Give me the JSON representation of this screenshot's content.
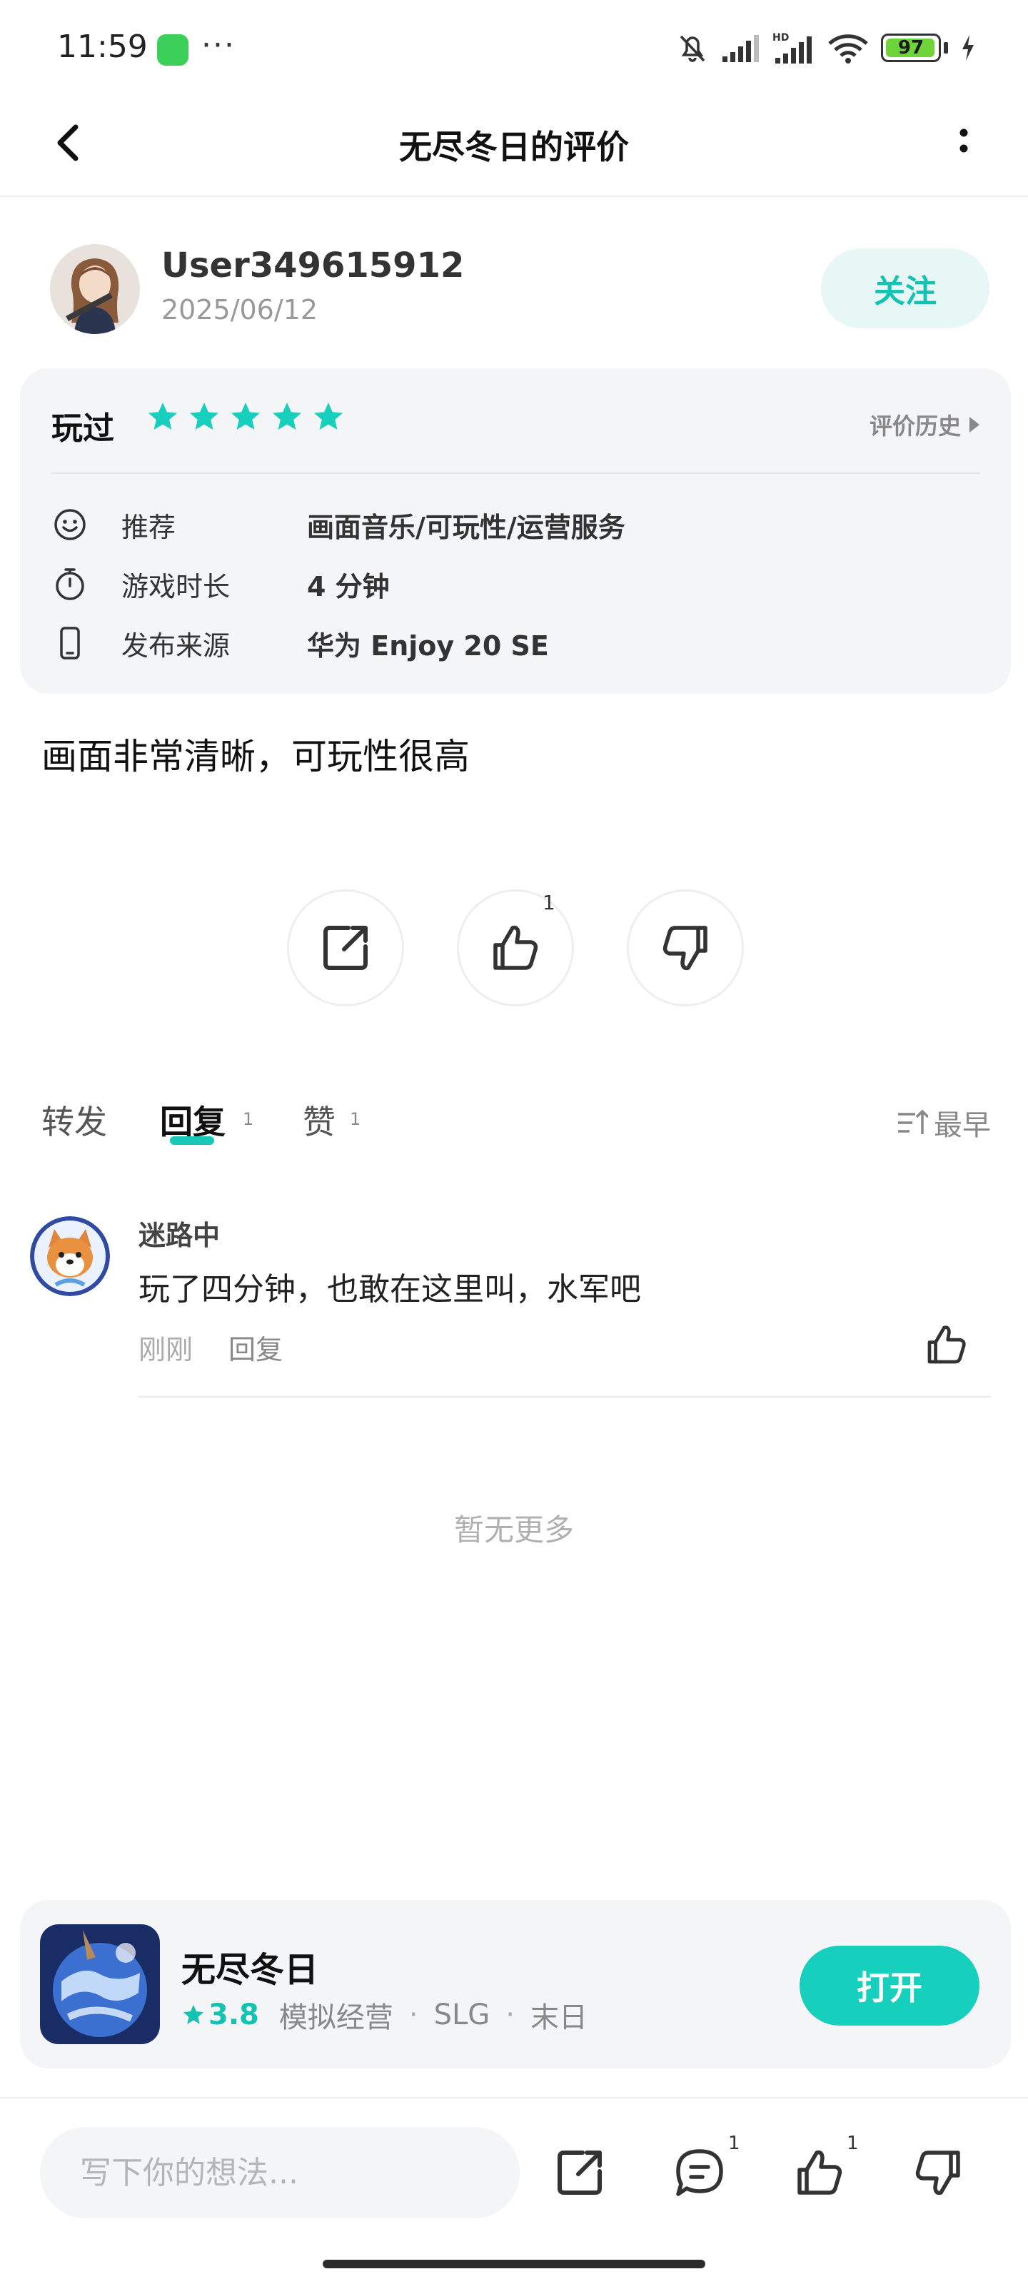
{
  "status_bar": {
    "time": "11:59",
    "dots": "···",
    "battery": "97",
    "battery_level": 0.97
  },
  "header": {
    "title": "无尽冬日的评价"
  },
  "user": {
    "name": "User349615912",
    "date": "2025/06/12",
    "follow_label": "关注"
  },
  "review_card": {
    "played_label": "玩过",
    "rating": 5,
    "history_label": "评价历史",
    "rows": [
      {
        "icon": "smile-icon",
        "label": "推荐",
        "value": "画面音乐/可玩性/运营服务"
      },
      {
        "icon": "timer-icon",
        "label": "游戏时长",
        "value": "4 分钟"
      },
      {
        "icon": "phone-icon",
        "label": "发布来源",
        "value": "华为 Enjoy 20 SE"
      }
    ]
  },
  "review_text": "画面非常清晰，可玩性很高",
  "actions": {
    "like_count": "1"
  },
  "tabs": [
    {
      "label": "转发",
      "count": ""
    },
    {
      "label": "回复",
      "count": "1"
    },
    {
      "label": "赞",
      "count": "1"
    }
  ],
  "sort_label": "最早",
  "comments": [
    {
      "name": "迷路中",
      "text": "玩了四分钟，也敢在这里叫，水军吧",
      "time": "刚刚",
      "reply_label": "回复"
    }
  ],
  "no_more": "暂无更多",
  "game": {
    "name": "无尽冬日",
    "rating": "3.8",
    "tags": [
      "模拟经营",
      "SLG",
      "末日"
    ],
    "open_label": "打开"
  },
  "bottom_bar": {
    "placeholder": "写下你的想法...",
    "comment_count": "1",
    "like_count": "1"
  },
  "colors": {
    "accent": "#17cfbd",
    "accent_light": "#e6f7f6",
    "card_bg": "#f4f5f7"
  }
}
